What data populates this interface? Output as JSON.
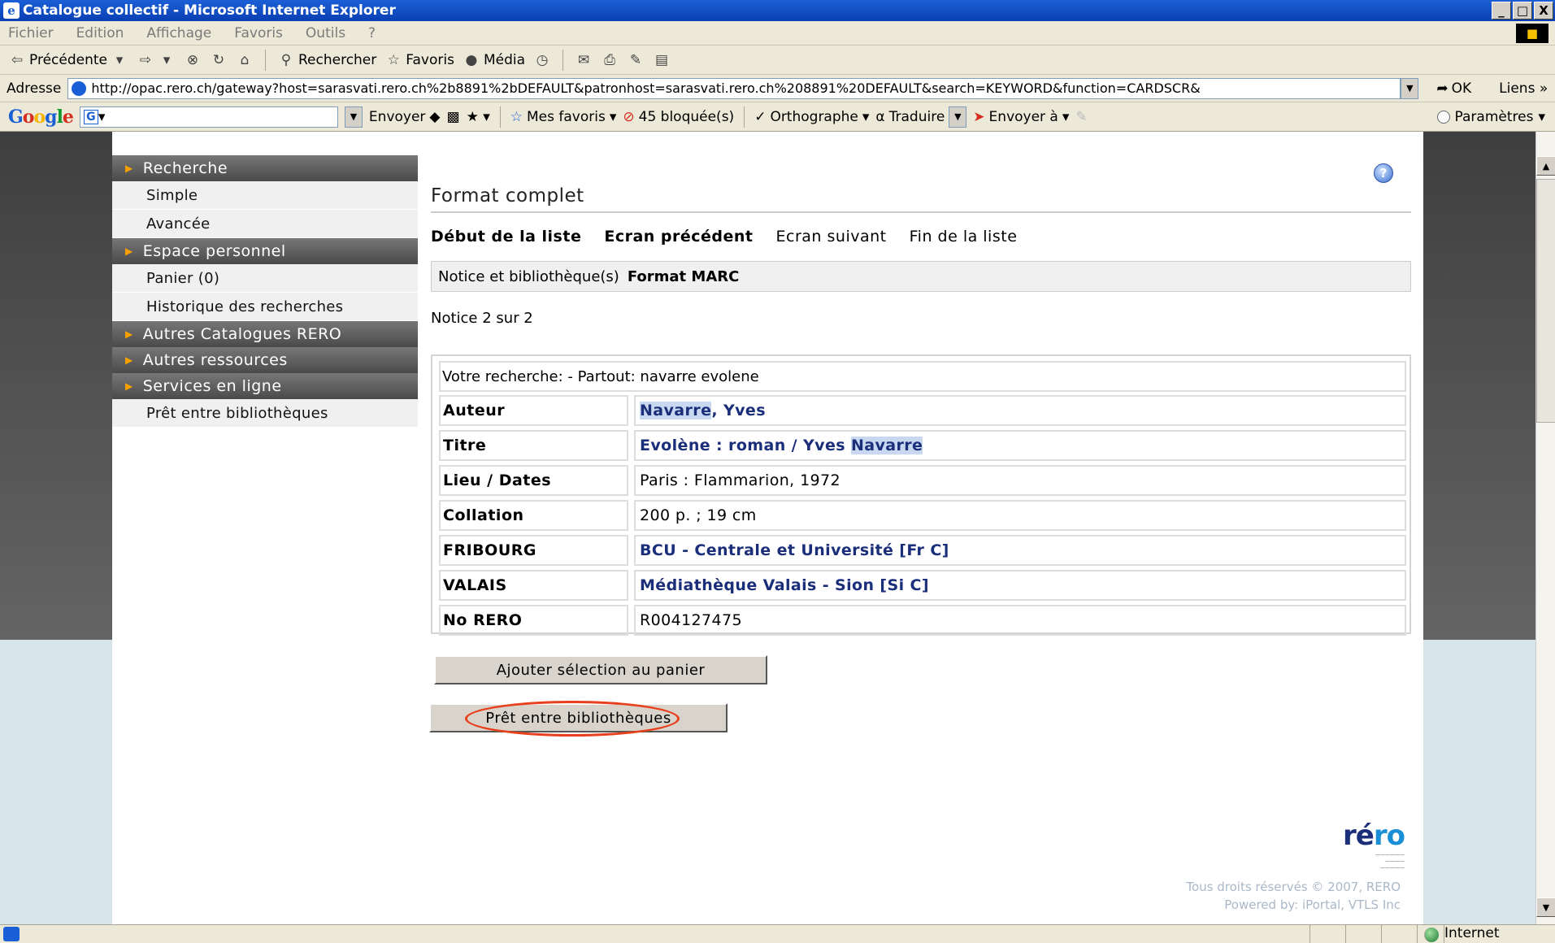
{
  "window": {
    "title": "Catalogue collectif - Microsoft Internet Explorer",
    "controls": [
      "_",
      "□",
      "X"
    ]
  },
  "menubar": [
    "Fichier",
    "Edition",
    "Affichage",
    "Favoris",
    "Outils",
    "?"
  ],
  "toolbar": {
    "back": "Précédente",
    "search": "Rechercher",
    "favorites": "Favoris",
    "media": "Média"
  },
  "addressbar": {
    "label": "Adresse",
    "url": "http://opac.rero.ch/gateway?host=sarasvati.rero.ch%2b8891%2bDEFAULT&patronhost=sarasvati.rero.ch%208891%20DEFAULT&search=KEYWORD&function=CARDSCR&",
    "go": "OK",
    "links": "Liens"
  },
  "googlebar": {
    "logo": [
      "G",
      "o",
      "o",
      "g",
      "l",
      "e"
    ],
    "send": "Envoyer",
    "favorites": "Mes favoris",
    "blocked": "45 bloquée(s)",
    "spelling": "Orthographe",
    "translate": "Traduire",
    "send_to": "Envoyer à",
    "settings": "Paramètres"
  },
  "sidebar": {
    "sections": [
      {
        "head": "Recherche",
        "items": [
          "Simple",
          "Avancée"
        ]
      },
      {
        "head": "Espace personnel",
        "items": [
          "Panier (0)",
          "Historique des recherches"
        ]
      },
      {
        "head": "Autres Catalogues RERO",
        "items": []
      },
      {
        "head": "Autres ressources",
        "items": []
      },
      {
        "head": "Services en ligne",
        "items": [
          "Prêt entre bibliothèques"
        ]
      }
    ]
  },
  "main": {
    "title": "Format complet",
    "nav": [
      "Début de la liste",
      "Ecran précédent",
      "Ecran suivant",
      "Fin de la liste"
    ],
    "tabs": [
      "Notice et bibliothèque(s)",
      "Format MARC"
    ],
    "notice_count": "Notice 2 sur 2",
    "search_summary": "Votre recherche: - Partout: navarre evolene",
    "record": {
      "author_label": "Auteur",
      "author_hl": "Navarre",
      "author_rest": ", Yves",
      "title_label": "Titre",
      "title_prefix": "Evolène : roman / Yves ",
      "title_hl": "Navarre",
      "place_label": "Lieu / Dates",
      "place_value": "Paris : Flammarion, 1972",
      "collation_label": "Collation",
      "collation_value": "200 p. ; 19 cm",
      "fribourg_label": "FRIBOURG",
      "fribourg_value": "BCU - Centrale et Université [Fr C]",
      "valais_label": "VALAIS",
      "valais_value": "Médiathèque Valais - Sion [Si C]",
      "rero_label": "No RERO",
      "rero_value": "R004127475"
    },
    "buttons": {
      "add_to_basket": "Ajouter sélection au panier",
      "ill": "Prêt entre bibliothèques"
    }
  },
  "logo": {
    "re": "ré",
    "ro": "ro"
  },
  "footer": {
    "copyright": "Tous droits réservés © 2007, RERO",
    "powered": "Powered by: iPortal, VTLS Inc"
  },
  "statusbar": {
    "zone": "Internet"
  },
  "colors": {
    "titlebar": "#1b5fd6",
    "link": "#1a2e7a",
    "highlight": "#c8d8f0",
    "annotation": "#e8401c"
  }
}
